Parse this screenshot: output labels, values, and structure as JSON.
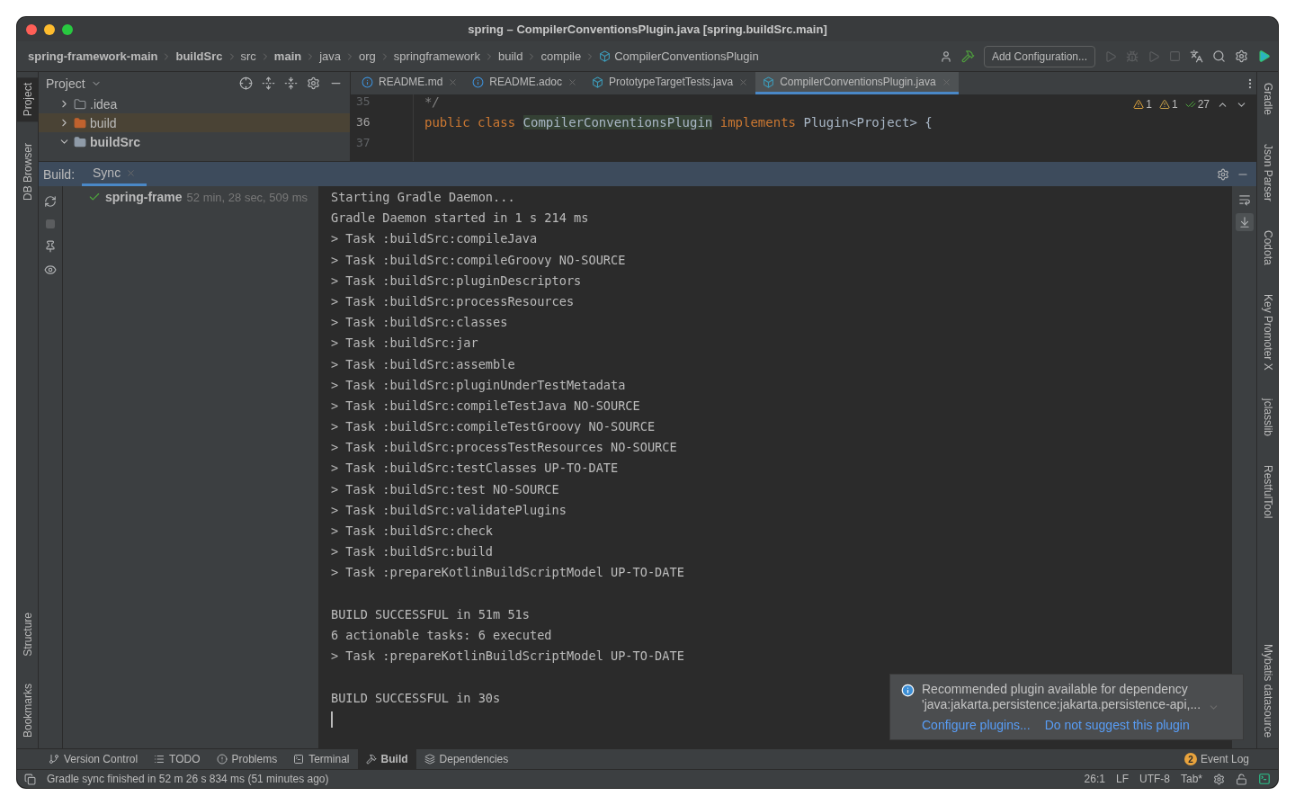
{
  "window": {
    "title": "spring – CompilerConventionsPlugin.java [spring.buildSrc.main]"
  },
  "breadcrumbs": [
    {
      "label": "spring-framework-main",
      "bold": true
    },
    {
      "label": "buildSrc",
      "bold": true
    },
    {
      "label": "src",
      "bold": false
    },
    {
      "label": "main",
      "bold": true
    },
    {
      "label": "java",
      "bold": false
    },
    {
      "label": "org",
      "bold": false
    },
    {
      "label": "springframework",
      "bold": false
    },
    {
      "label": "build",
      "bold": false
    },
    {
      "label": "compile",
      "bold": false
    },
    {
      "label": "CompilerConventionsPlugin",
      "bold": false,
      "kind": "class"
    }
  ],
  "toolbar": {
    "add_configuration": "Add Configuration..."
  },
  "left_stripe": {
    "top": [
      {
        "label": "Project",
        "selected": true
      },
      {
        "label": "DB Browser",
        "selected": false
      }
    ],
    "bottom": [
      {
        "label": "Structure",
        "selected": false
      },
      {
        "label": "Bookmarks",
        "selected": false
      }
    ]
  },
  "right_stripe": [
    {
      "label": "Gradle"
    },
    {
      "label": "Json Parser"
    },
    {
      "label": "Codota"
    },
    {
      "label": "Key Promoter X"
    },
    {
      "label": "jclasslib"
    },
    {
      "label": "RestfulTool"
    },
    {
      "label": "Mybatis datasource"
    }
  ],
  "project_panel": {
    "title": "Project",
    "items": [
      {
        "label": ".idea",
        "kind": "plain",
        "expanded": false
      },
      {
        "label": "build",
        "kind": "excluded",
        "expanded": false
      },
      {
        "label": "buildSrc",
        "kind": "module",
        "expanded": true
      }
    ]
  },
  "editor_tabs": [
    {
      "label": "README.md",
      "kind": "info",
      "selected": false
    },
    {
      "label": "README.adoc",
      "kind": "info",
      "selected": false
    },
    {
      "label": "PrototypeTargetTests.java",
      "kind": "test",
      "selected": false
    },
    {
      "label": "CompilerConventionsPlugin.java",
      "kind": "class",
      "selected": true
    }
  ],
  "editor": {
    "lines": [
      {
        "number": "35",
        "tokens": [
          {
            "text": "*/",
            "kind": "comment"
          }
        ],
        "current": false
      },
      {
        "number": "36",
        "tokens": [
          {
            "text": "public class ",
            "kind": "keyword"
          },
          {
            "text": "CompilerConventionsPlugin",
            "kind": "declaration"
          },
          {
            "text": " implements ",
            "kind": "keyword"
          },
          {
            "text": "Plugin<Project> {",
            "kind": "plain"
          }
        ],
        "current": true
      },
      {
        "number": "37",
        "current": false
      }
    ],
    "inspections": {
      "warnings": "1",
      "weak_warnings": "1",
      "typos": "27"
    }
  },
  "build_panel": {
    "label": "Build:",
    "tabs": [
      {
        "label": "Sync",
        "selected": true
      }
    ],
    "tree": [
      {
        "label": "spring-frame",
        "time": "52 min, 28 sec, 509 ms"
      }
    ],
    "console": [
      {
        "kind": "text",
        "text": "Starting Gradle Daemon..."
      },
      {
        "kind": "text",
        "text": "Gradle Daemon started in 1 s 214 ms"
      },
      {
        "kind": "text",
        "text": "> Task :buildSrc:compileJava"
      },
      {
        "kind": "text",
        "text": "> Task :buildSrc:compileGroovy NO-SOURCE"
      },
      {
        "kind": "text",
        "text": "> Task :buildSrc:pluginDescriptors"
      },
      {
        "kind": "text",
        "text": "> Task :buildSrc:processResources"
      },
      {
        "kind": "text",
        "text": "> Task :buildSrc:classes"
      },
      {
        "kind": "text",
        "text": "> Task :buildSrc:jar"
      },
      {
        "kind": "text",
        "text": "> Task :buildSrc:assemble"
      },
      {
        "kind": "text",
        "text": "> Task :buildSrc:pluginUnderTestMetadata"
      },
      {
        "kind": "text",
        "text": "> Task :buildSrc:compileTestJava NO-SOURCE"
      },
      {
        "kind": "text",
        "text": "> Task :buildSrc:compileTestGroovy NO-SOURCE"
      },
      {
        "kind": "text",
        "text": "> Task :buildSrc:processTestResources NO-SOURCE"
      },
      {
        "kind": "text",
        "text": "> Task :buildSrc:testClasses UP-TO-DATE"
      },
      {
        "kind": "text",
        "text": "> Task :buildSrc:test NO-SOURCE"
      },
      {
        "kind": "text",
        "text": "> Task :buildSrc:validatePlugins"
      },
      {
        "kind": "text",
        "text": "> Task :buildSrc:check"
      },
      {
        "kind": "text",
        "text": "> Task :buildSrc:build"
      },
      {
        "kind": "text",
        "text": "> Task :prepareKotlinBuildScriptModel UP-TO-DATE"
      },
      {
        "kind": "blank"
      },
      {
        "kind": "text",
        "text": "BUILD SUCCESSFUL in 51m 51s"
      },
      {
        "kind": "text",
        "text": "6 actionable tasks: 6 executed"
      },
      {
        "kind": "text",
        "text": "> Task :prepareKotlinBuildScriptModel UP-TO-DATE"
      },
      {
        "kind": "blank"
      },
      {
        "kind": "text",
        "text": "BUILD SUCCESSFUL in 30s"
      },
      {
        "kind": "caret"
      }
    ]
  },
  "notification": {
    "title": "Recommended plugin available for dependency",
    "detail": "'java:jakarta.persistence:jakarta.persistence-api,...",
    "links": [
      "Configure plugins...",
      "Do not suggest this plugin"
    ]
  },
  "tool_tabs": [
    {
      "label": "Version Control",
      "kind": "vcs",
      "selected": false
    },
    {
      "label": "TODO",
      "kind": "todo",
      "selected": false
    },
    {
      "label": "Problems",
      "kind": "problems",
      "selected": false
    },
    {
      "label": "Terminal",
      "kind": "terminal",
      "selected": false
    },
    {
      "label": "Build",
      "kind": "build",
      "selected": true
    },
    {
      "label": "Dependencies",
      "kind": "dependencies",
      "selected": false
    }
  ],
  "event_log": {
    "label": "Event Log",
    "count": "2"
  },
  "status_bar": {
    "message": "Gradle sync finished in 52 m 26 s 834 ms (51 minutes ago)",
    "position": "26:1",
    "line_separator": "LF",
    "encoding": "UTF-8",
    "indent": "Tab*"
  }
}
